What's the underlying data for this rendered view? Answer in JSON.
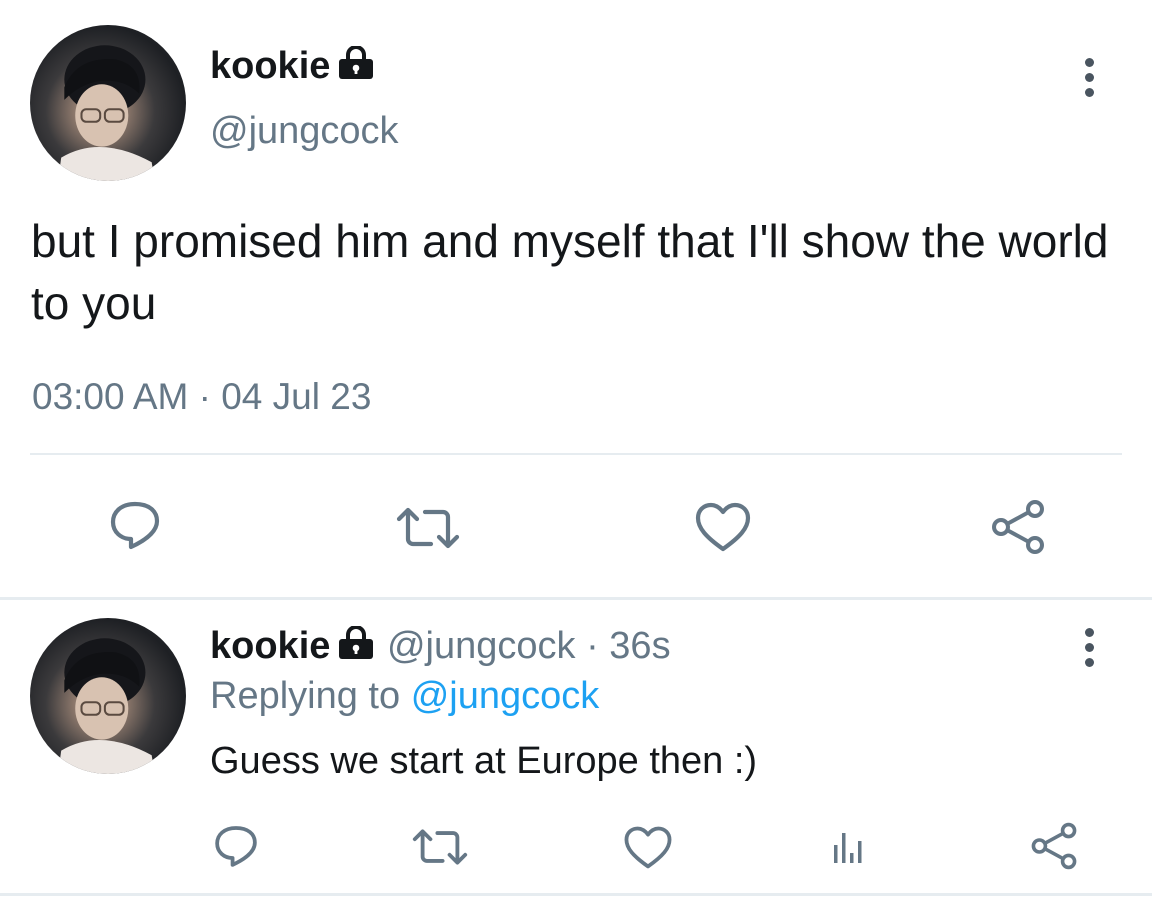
{
  "main_tweet": {
    "name": "kookie",
    "handle": "@jungcock",
    "text": "but I promised him and myself that I'll show the world to you",
    "time": "03:00 AM",
    "separator": "·",
    "date": "04 Jul 23",
    "actions": [
      "reply-icon",
      "retweet-icon",
      "like-icon",
      "share-icon"
    ]
  },
  "reply_tweet": {
    "name": "kookie",
    "handle": "@jungcock",
    "separator": "·",
    "age": "36s",
    "replying_prefix": "Replying to",
    "replying_to": "@jungcock",
    "text": "Guess we start at Europe then :)",
    "actions": [
      "reply-icon",
      "retweet-icon",
      "like-icon",
      "analytics-icon",
      "share-icon"
    ]
  },
  "colors": {
    "text": "#14171a",
    "secondary": "#657786",
    "link": "#1da1f2",
    "divider": "#e6ecf0",
    "icon": "#657786"
  }
}
